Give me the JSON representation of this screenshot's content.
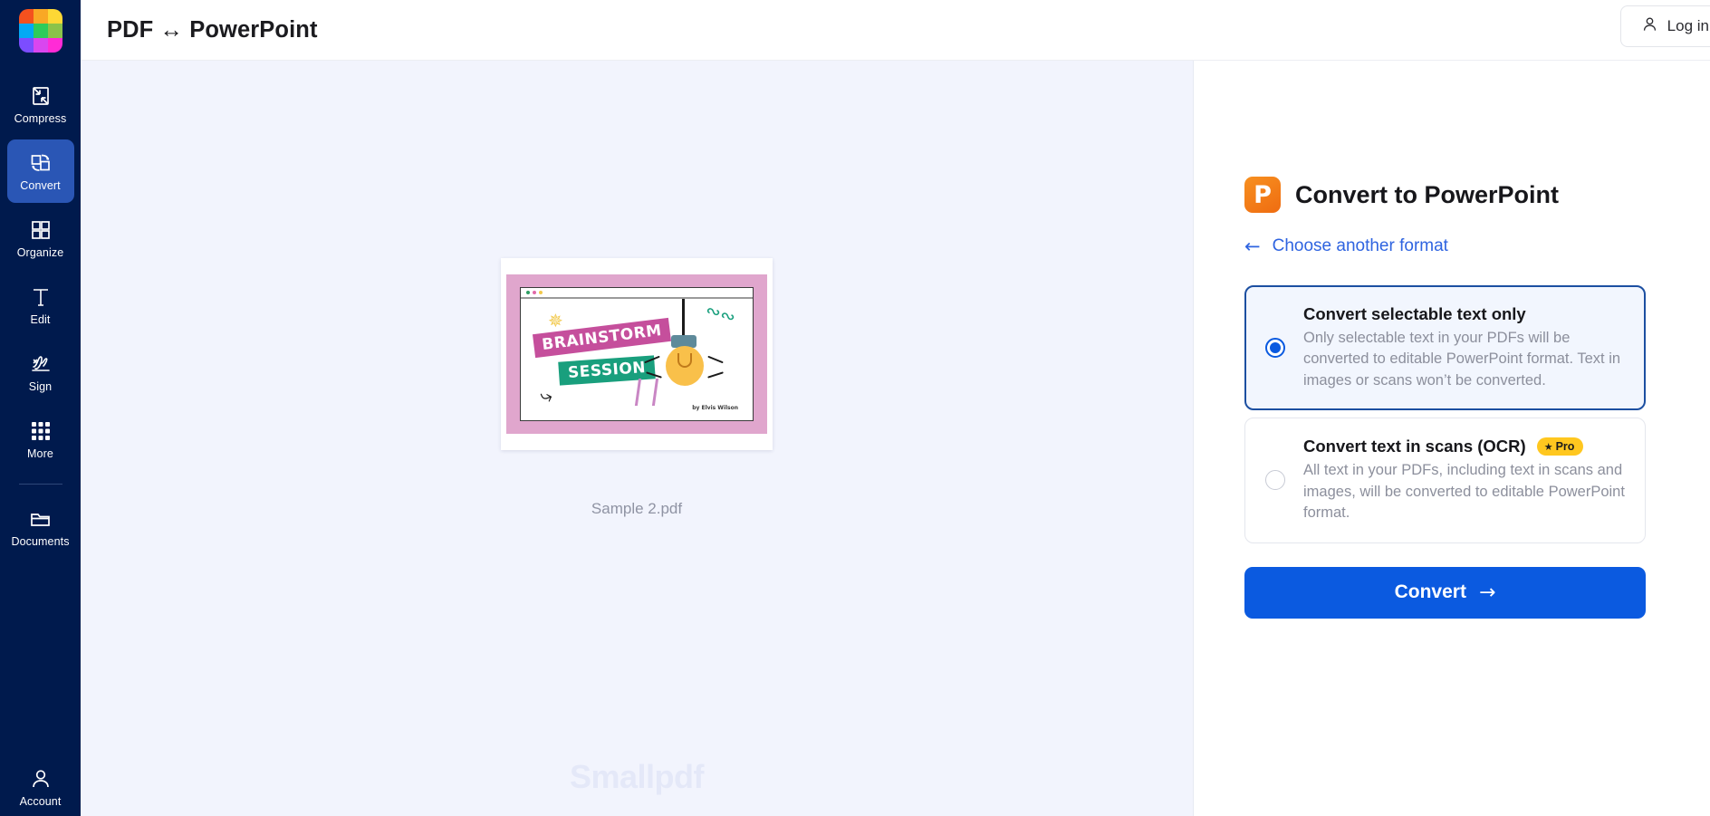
{
  "app": {
    "logo_name": "smallpdf-logo",
    "logo_colors": [
      "#f4511e",
      "#f9a825",
      "#fdd835",
      "#03a9f4",
      "#2ecc5b",
      "#8bc34a",
      "#7c4dff",
      "#d946ef",
      "#ff2bd6"
    ]
  },
  "topbar": {
    "title": "PDF ↔ PowerPoint",
    "login_label": "Log in",
    "login_icon": "user-icon"
  },
  "sidebar": {
    "items": [
      {
        "label": "Compress",
        "icon": "compress-icon",
        "active": false
      },
      {
        "label": "Convert",
        "icon": "convert-icon",
        "active": true
      },
      {
        "label": "Organize",
        "icon": "organize-grid-icon",
        "active": false
      },
      {
        "label": "Edit",
        "icon": "text-edit-icon",
        "active": false
      },
      {
        "label": "Sign",
        "icon": "signature-icon",
        "active": false
      },
      {
        "label": "More",
        "icon": "dots-grid-icon",
        "active": false
      },
      {
        "label": "Documents",
        "icon": "folder-icon",
        "active": false
      }
    ],
    "account": {
      "label": "Account",
      "icon": "account-avatar-icon"
    }
  },
  "canvas": {
    "file_name": "Sample 2.pdf",
    "watermark": "Smallpdf",
    "thumbnail": {
      "title_line1": "BRAINSTORM",
      "title_line2": "SESSION",
      "byline": "by Elvis Wilson",
      "frame_color": "#e0a6cd",
      "tag1_color": "#c54f9c",
      "tag2_color": "#199f7d",
      "bulb_color": "#f9c04a"
    }
  },
  "panel": {
    "icon": "powerpoint-icon",
    "icon_letter": "P",
    "title": "Convert to PowerPoint",
    "back_link": "Choose another format",
    "back_icon": "arrow-left-icon",
    "accent_color": "#0b5ae0",
    "options": [
      {
        "title": "Convert selectable text only",
        "description": "Only selectable text in your PDFs will be converted to editable PowerPoint format. Text in images or scans won’t be converted.",
        "selected": true,
        "badge": null
      },
      {
        "title": "Convert text in scans (OCR)",
        "description": "All text in your PDFs, including text in scans and images, will be converted to editable PowerPoint format.",
        "selected": false,
        "badge": "Pro"
      }
    ],
    "convert_label": "Convert",
    "convert_arrow": "→"
  }
}
